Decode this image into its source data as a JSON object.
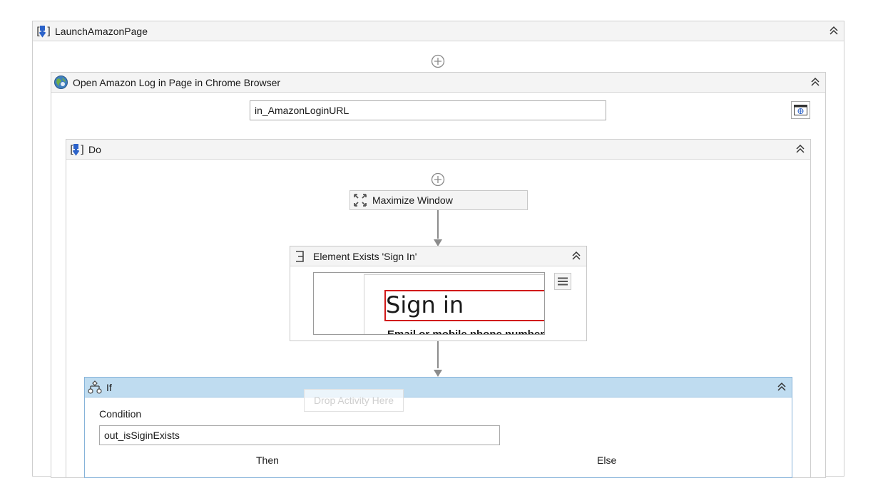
{
  "launch": {
    "title": "LaunchAmazonPage"
  },
  "open_browser": {
    "title": "Open Amazon Log in Page in Chrome Browser",
    "url_value": "in_AmazonLoginURL"
  },
  "do": {
    "title": "Do"
  },
  "maximize": {
    "label": "Maximize Window"
  },
  "element_exists": {
    "title": "Element Exists 'Sign In'",
    "preview_text": "Sign in",
    "preview_subtext": "Email or mobile phone number"
  },
  "if_block": {
    "title": "If",
    "condition_label": "Condition",
    "condition_value": "out_isSiginExists",
    "then_label": "Then",
    "else_label": "Else",
    "drop_hint": "Drop Activity Here"
  }
}
